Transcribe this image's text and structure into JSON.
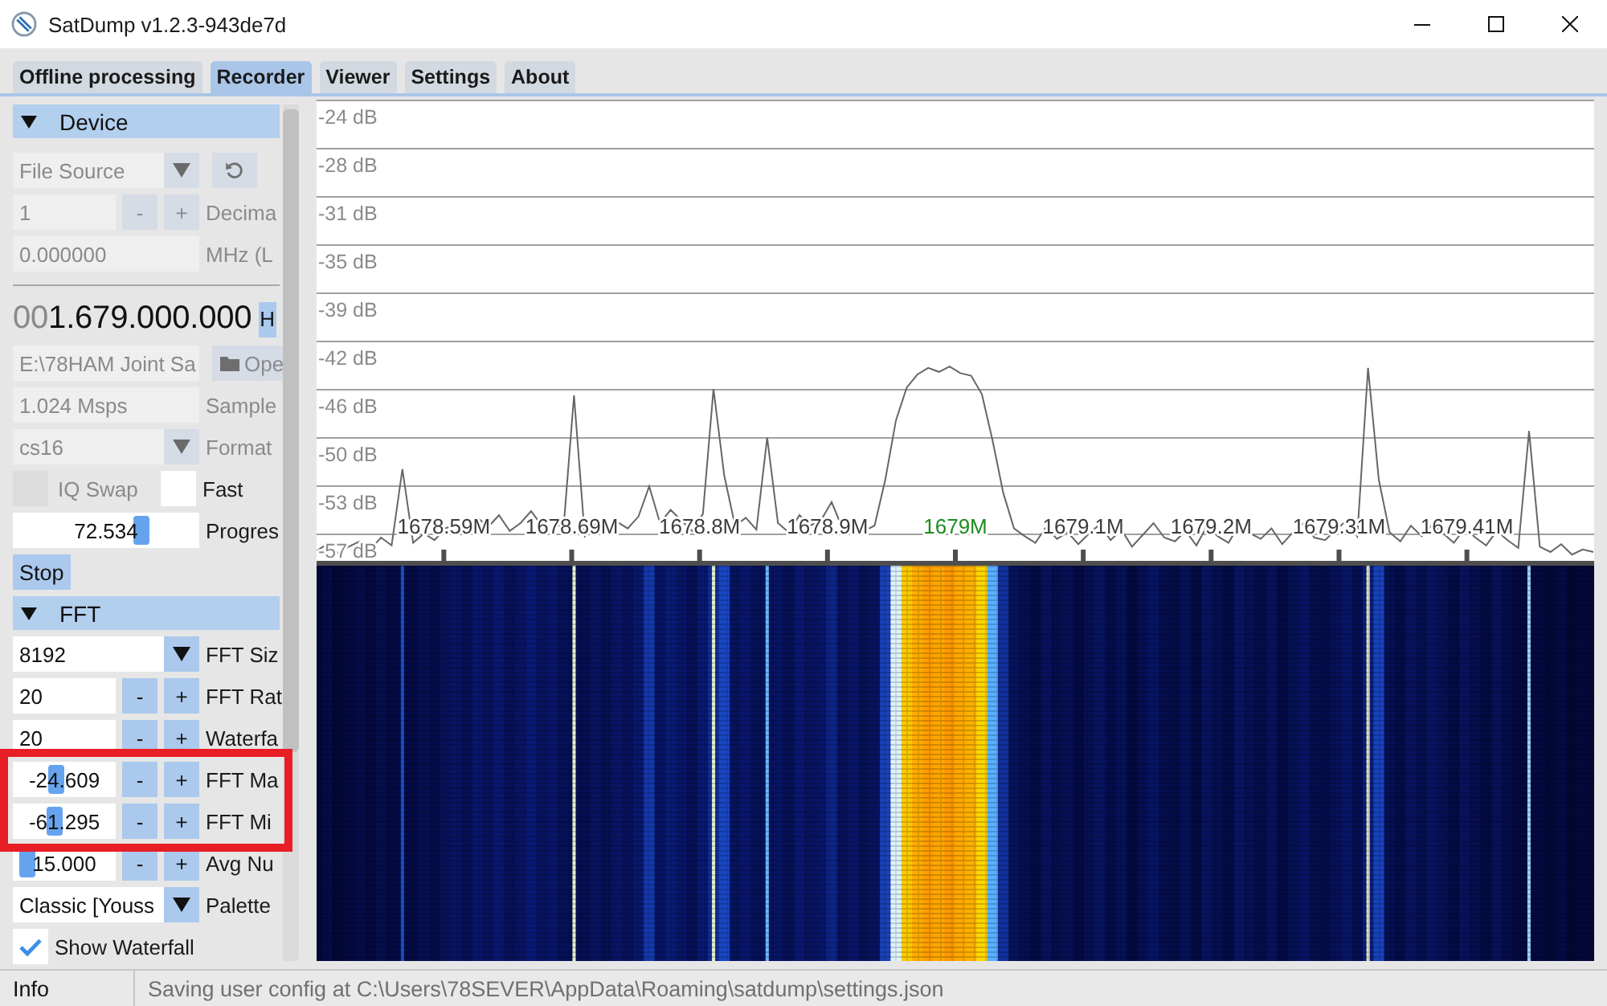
{
  "window": {
    "title": "SatDump v1.2.3-943de7d"
  },
  "tabs": [
    {
      "label": "Offline processing",
      "selected": false
    },
    {
      "label": "Recorder",
      "selected": true
    },
    {
      "label": "Viewer",
      "selected": false
    },
    {
      "label": "Settings",
      "selected": false
    },
    {
      "label": "About",
      "selected": false
    }
  ],
  "sidebar": {
    "sections": [
      {
        "title": "Device",
        "expanded": true,
        "rows": [
          {
            "kind": "combo",
            "value": "File Source",
            "disabled": true,
            "refresh_button": true
          },
          {
            "kind": "stepper",
            "value": "1",
            "buttons": [
              "-",
              "+"
            ],
            "label": "Decima",
            "disabled": true
          },
          {
            "kind": "field",
            "value": "0.000000",
            "label": "MHz (L",
            "disabled": true
          },
          {
            "kind": "divider"
          },
          {
            "kind": "frequency",
            "leading_zeros": "00",
            "value": "1.679.000.000",
            "button": "H"
          },
          {
            "kind": "file",
            "value": "E:\\78HAM Joint Sa",
            "button": "Ope",
            "disabled": true
          },
          {
            "kind": "field",
            "value": "1.024 Msps",
            "label": "Sample",
            "disabled": true
          },
          {
            "kind": "combo",
            "value": "cs16",
            "label": "Format",
            "disabled": true
          },
          {
            "kind": "checkboxes",
            "items": [
              {
                "label": "IQ Swap",
                "checked": false,
                "disabled": true
              },
              {
                "label": "Fast",
                "checked": false,
                "disabled": false
              }
            ]
          },
          {
            "kind": "slider",
            "value": "72.534",
            "level": 0.71,
            "label": "Progres",
            "disabled": false
          },
          {
            "kind": "button",
            "text": "Stop"
          }
        ]
      },
      {
        "title": "FFT",
        "expanded": true,
        "rows": [
          {
            "kind": "combo",
            "value": "8192",
            "label": "FFT Siz",
            "disabled": false
          },
          {
            "kind": "stepper",
            "value": "20",
            "buttons": [
              "-",
              "+"
            ],
            "label": "FFT Rat",
            "disabled": false
          },
          {
            "kind": "stepper",
            "value": "20",
            "buttons": [
              "-",
              "+"
            ],
            "label": "Waterfa",
            "disabled": false
          },
          {
            "kind": "highlight_group",
            "rows": [
              {
                "kind": "slider_stepper",
                "value": "-24.609",
                "level": 0.41,
                "buttons": [
                  "-",
                  "+"
                ],
                "label": "FFT Ma",
                "disabled": false
              },
              {
                "kind": "slider_stepper",
                "value": "-61.295",
                "level": 0.39,
                "buttons": [
                  "-",
                  "+"
                ],
                "label": "FFT Mi",
                "disabled": false
              }
            ]
          },
          {
            "kind": "slider_stepper",
            "value": "15.000",
            "level": 0.07,
            "buttons": [
              "-",
              "+"
            ],
            "label": "Avg Nu",
            "disabled": false
          },
          {
            "kind": "combo",
            "value": "Classic [Youss",
            "label": "Palette",
            "disabled": false
          },
          {
            "kind": "checkbox",
            "label": "Show Waterfall",
            "checked": true,
            "disabled": false
          }
        ]
      }
    ]
  },
  "spectrum": {
    "chart_data": {
      "type": "line",
      "grid": true,
      "xlim": [
        1678.488,
        1679.512
      ],
      "ylim": [
        -59.44,
        -24
      ],
      "xticks": [
        {
          "value": 1678.59,
          "label": "1678.59M"
        },
        {
          "value": 1678.6925,
          "label": "1678.69M"
        },
        {
          "value": 1678.795,
          "label": "1678.8M"
        },
        {
          "value": 1678.8975,
          "label": "1678.9M"
        },
        {
          "value": 1679,
          "label": "1679M"
        },
        {
          "value": 1679.1025,
          "label": "1679.1M"
        },
        {
          "value": 1679.205,
          "label": "1679.2M"
        },
        {
          "value": 1679.3075,
          "label": "1679.31M"
        },
        {
          "value": 1679.41,
          "label": "1679.41M"
        }
      ],
      "yticks": [
        {
          "value": -24,
          "label": "-24 dB"
        },
        {
          "value": -27.667,
          "label": "-28 dB"
        },
        {
          "value": -31.333,
          "label": "-31 dB"
        },
        {
          "value": -35,
          "label": "-35 dB"
        },
        {
          "value": -38.667,
          "label": "-39 dB"
        },
        {
          "value": -42.333,
          "label": "-42 dB"
        },
        {
          "value": -46,
          "label": "-46 dB"
        },
        {
          "value": -49.667,
          "label": "-50 dB"
        },
        {
          "value": -53.333,
          "label": "-53 dB"
        },
        {
          "value": -57,
          "label": "-57 dB"
        }
      ],
      "x": [
        1678.488,
        1678.4966,
        1678.5052,
        1678.5138,
        1678.5224,
        1678.531,
        1678.5396,
        1678.5482,
        1678.5568,
        1678.5654,
        1678.574,
        1678.5826,
        1678.5912,
        1678.5998,
        1678.6084,
        1678.617,
        1678.6256,
        1678.6342,
        1678.6428,
        1678.6514,
        1678.66,
        1678.6686,
        1678.6772,
        1678.6858,
        1678.6944,
        1678.703,
        1678.7116,
        1678.7202,
        1678.7288,
        1678.7374,
        1678.746,
        1678.7546,
        1678.7632,
        1678.7718,
        1678.7804,
        1678.789,
        1678.7976,
        1678.8062,
        1678.8148,
        1678.8234,
        1678.832,
        1678.8406,
        1678.8492,
        1678.8578,
        1678.8664,
        1678.875,
        1678.8836,
        1678.8922,
        1678.9008,
        1678.9094,
        1678.918,
        1678.9266,
        1678.9352,
        1678.9438,
        1678.9524,
        1678.961,
        1678.9696,
        1678.9782,
        1678.9868,
        1678.9954,
        1679.004,
        1679.0126,
        1679.0212,
        1679.0298,
        1679.0384,
        1679.047,
        1679.0556,
        1679.0642,
        1679.0728,
        1679.0814,
        1679.09,
        1679.0986,
        1679.1072,
        1679.1158,
        1679.1244,
        1679.133,
        1679.1416,
        1679.1502,
        1679.1588,
        1679.1674,
        1679.176,
        1679.1846,
        1679.1932,
        1679.2018,
        1679.2104,
        1679.219,
        1679.2276,
        1679.2362,
        1679.2448,
        1679.2534,
        1679.262,
        1679.2706,
        1679.2792,
        1679.2878,
        1679.2964,
        1679.305,
        1679.3136,
        1679.3222,
        1679.3308,
        1679.3394,
        1679.348,
        1679.3566,
        1679.3652,
        1679.3738,
        1679.3824,
        1679.391,
        1679.3996,
        1679.4082,
        1679.4168,
        1679.4254,
        1679.434,
        1679.4426,
        1679.4512,
        1679.4598,
        1679.4684,
        1679.477,
        1679.4856,
        1679.4942,
        1679.5028,
        1679.5114
      ],
      "series": [
        {
          "color": "#666666",
          "values": [
            -58.3,
            -57.8,
            -58.5,
            -58.0,
            -57.6,
            -58.2,
            -57.3,
            -57.9,
            -52.1,
            -57.7,
            -57.0,
            -57.5,
            -56.6,
            -56.3,
            -56.9,
            -55.8,
            -56.5,
            -55.6,
            -56.8,
            -56.2,
            -55.3,
            -56.4,
            -55.9,
            -56.7,
            -46.5,
            -57.2,
            -56.3,
            -57.0,
            -56.1,
            -56.6,
            -55.7,
            -53.4,
            -56.2,
            -55.2,
            -56.0,
            -56.8,
            -55.5,
            -46.0,
            -52.6,
            -56.4,
            -55.8,
            -56.7,
            -49.7,
            -56.2,
            -56.9,
            -55.6,
            -56.4,
            -56.0,
            -54.6,
            -56.6,
            -55.9,
            -56.8,
            -56.4,
            -52.9,
            -48.4,
            -45.9,
            -44.9,
            -44.4,
            -44.7,
            -44.3,
            -44.8,
            -45.0,
            -46.4,
            -49.9,
            -53.9,
            -56.6,
            -57.2,
            -57.7,
            -56.5,
            -57.4,
            -56.9,
            -57.8,
            -57.0,
            -56.3,
            -57.5,
            -56.7,
            -58.0,
            -57.1,
            -56.2,
            -57.3,
            -57.6,
            -56.8,
            -57.9,
            -56.4,
            -57.2,
            -57.7,
            -56.3,
            -57.0,
            -57.4,
            -56.6,
            -57.8,
            -56.9,
            -56.2,
            -57.3,
            -57.5,
            -56.7,
            -56.0,
            -57.2,
            -44.4,
            -52.9,
            -56.9,
            -57.6,
            -56.4,
            -57.2,
            -56.3,
            -57.0,
            -57.7,
            -56.6,
            -57.3,
            -57.9,
            -56.8,
            -57.5,
            -58.1,
            -49.2,
            -58.0,
            -58.4,
            -57.8,
            -58.6,
            -58.2,
            -58.4
          ]
        }
      ]
    }
  },
  "status_bar": {
    "label": "Info",
    "message": "Saving user config at C:\\Users\\78SEVER\\AppData\\Roaming\\satdump\\settings.json"
  }
}
